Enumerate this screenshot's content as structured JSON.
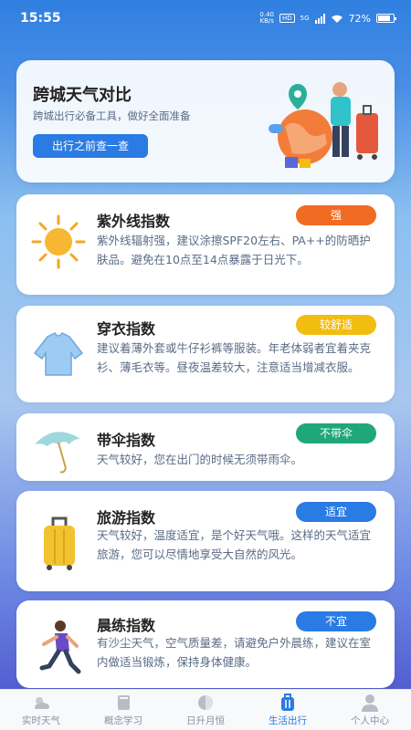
{
  "status_bar": {
    "time": "15:55",
    "net_speed": "0.40",
    "net_unit": "KB/s",
    "hd": "HD",
    "network": "5G",
    "battery": "72%"
  },
  "hero": {
    "title": "跨城天气对比",
    "subtitle": "跨城出行必备工具，做好全面准备",
    "button_label": "出行之前查一查"
  },
  "cards": [
    {
      "title": "紫外线指数",
      "badge": "强",
      "badge_color": "#f26b22",
      "icon": "sun-icon",
      "description": "紫外线辐射强，建议涂擦SPF20左右、PA++的防晒护肤品。避免在10点至14点暴露于日光下。"
    },
    {
      "title": "穿衣指数",
      "badge": "较舒适",
      "badge_color": "#f2bd11",
      "icon": "sweater-icon",
      "description": "建议着薄外套或牛仔衫裤等服装。年老体弱者宜着夹克衫、薄毛衣等。昼夜温差较大，注意适当增减衣服。"
    },
    {
      "title": "带伞指数",
      "badge": "不带伞",
      "badge_color": "#1fa77a",
      "icon": "umbrella-icon",
      "description": "天气较好，您在出门的时候无须带雨伞。"
    },
    {
      "title": "旅游指数",
      "badge": "适宜",
      "badge_color": "#2a7be3",
      "icon": "suitcase-icon",
      "description": "天气较好，温度适宜，是个好天气哦。这样的天气适宜旅游，您可以尽情地享受大自然的风光。"
    },
    {
      "title": "晨练指数",
      "badge": "不宜",
      "badge_color": "#2a7be3",
      "icon": "runner-icon",
      "description": "有沙尘天气，空气质量差，请避免户外晨练，建议在室内做适当锻炼，保持身体健康。"
    }
  ],
  "bottom_nav": [
    {
      "label": "实时天气",
      "icon": "weather-icon"
    },
    {
      "label": "概念学习",
      "icon": "book-icon"
    },
    {
      "label": "日升月恒",
      "icon": "moon-icon"
    },
    {
      "label": "生活出行",
      "icon": "luggage-icon",
      "active": true
    },
    {
      "label": "个人中心",
      "icon": "user-icon"
    }
  ],
  "colors": {
    "accent": "#2a7be3",
    "text_primary": "#222222",
    "text_secondary": "#5a6b85"
  }
}
